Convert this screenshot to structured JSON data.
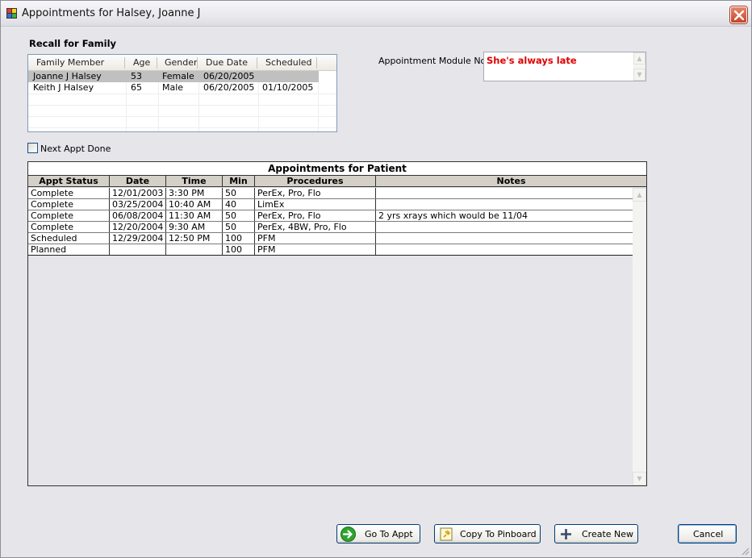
{
  "window": {
    "title": "Appointments for Halsey, Joanne J"
  },
  "recall": {
    "section_label": "Recall for Family",
    "columns": [
      "Family Member",
      "Age",
      "Gender",
      "Due Date",
      "Scheduled"
    ],
    "rows": [
      [
        "Joanne J Halsey",
        "53",
        "Female",
        "06/20/2005",
        ""
      ],
      [
        "Keith J Halsey",
        "65",
        "Male",
        "06/20/2005",
        "01/10/2005"
      ]
    ]
  },
  "next_appt_done": {
    "label": "Next Appt Done",
    "checked": false
  },
  "module_note": {
    "label": "Appointment Module Note",
    "value": "She's always late",
    "color": "#E00000"
  },
  "appointments": {
    "title": "Appointments for Patient",
    "columns": [
      "Appt Status",
      "Date",
      "Time",
      "Min",
      "Procedures",
      "Notes"
    ],
    "rows": [
      [
        "Complete",
        "12/01/2003",
        "3:30 PM",
        "50",
        "PerEx, Pro, Flo",
        ""
      ],
      [
        "Complete",
        "03/25/2004",
        "10:40 AM",
        "40",
        "LimEx",
        ""
      ],
      [
        "Complete",
        "06/08/2004",
        "11:30 AM",
        "50",
        "PerEx, Pro, Flo",
        "2 yrs xrays which would be 11/04"
      ],
      [
        "Complete",
        "12/20/2004",
        "9:30 AM",
        "50",
        "PerEx, 4BW, Pro, Flo",
        ""
      ],
      [
        "Scheduled",
        "12/29/2004",
        "12:50 PM",
        "100",
        "PFM",
        ""
      ],
      [
        "Planned",
        "",
        "",
        "100",
        "PFM",
        ""
      ]
    ]
  },
  "buttons": {
    "go_to_appt": "Go To Appt",
    "copy_to_pinboard": "Copy To Pinboard",
    "create_new": "Create New",
    "cancel": "Cancel"
  },
  "icons": {
    "go_to_appt": "green-arrow-right-icon",
    "copy_to_pinboard": "pin-icon",
    "create_new": "plus-icon",
    "close": "close-icon"
  }
}
